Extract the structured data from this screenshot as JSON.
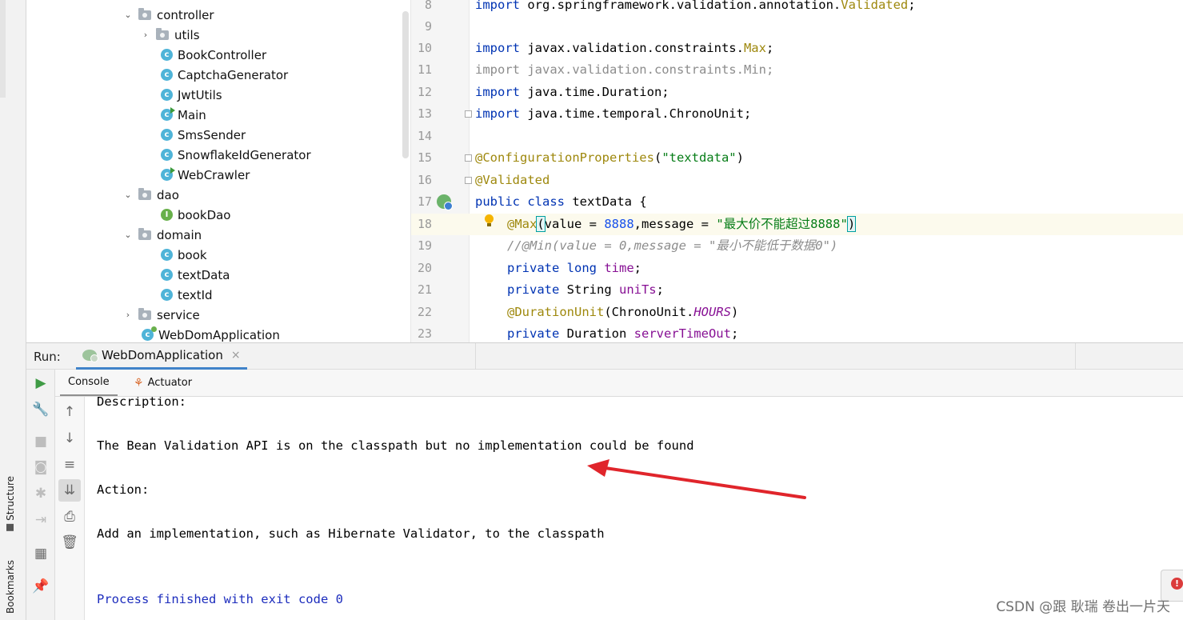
{
  "sidebar": {
    "structure_label": "Structure",
    "bookmarks_label": "Bookmarks"
  },
  "tree": {
    "items": [
      {
        "label": "controller",
        "type": "folder",
        "expanded": true,
        "indent": 0
      },
      {
        "label": "utils",
        "type": "folder",
        "expanded": false,
        "indent": 1
      },
      {
        "label": "BookController",
        "type": "class",
        "indent": 2
      },
      {
        "label": "CaptchaGenerator",
        "type": "class",
        "indent": 2
      },
      {
        "label": "JwtUtils",
        "type": "class",
        "indent": 2
      },
      {
        "label": "Main",
        "type": "runnable-class",
        "indent": 2
      },
      {
        "label": "SmsSender",
        "type": "class",
        "indent": 2
      },
      {
        "label": "SnowflakeIdGenerator",
        "type": "class",
        "indent": 2
      },
      {
        "label": "WebCrawler",
        "type": "runnable-class",
        "indent": 2
      },
      {
        "label": "dao",
        "type": "folder",
        "expanded": true,
        "indent": 0
      },
      {
        "label": "bookDao",
        "type": "interface",
        "indent": 2
      },
      {
        "label": "domain",
        "type": "folder",
        "expanded": true,
        "indent": 0
      },
      {
        "label": "book",
        "type": "class",
        "indent": 2
      },
      {
        "label": "textData",
        "type": "class",
        "indent": 2
      },
      {
        "label": "textId",
        "type": "class",
        "indent": 2
      },
      {
        "label": "service",
        "type": "folder",
        "expanded": false,
        "indent": 0
      },
      {
        "label": "WebDomApplication",
        "type": "spring-class",
        "indent": 0
      }
    ]
  },
  "editor": {
    "line_numbers": [
      "8",
      "9",
      "10",
      "11",
      "12",
      "13",
      "14",
      "15",
      "16",
      "17",
      "18",
      "19",
      "20",
      "21",
      "22",
      "23"
    ],
    "current_line": "18",
    "code": {
      "l8_kw": "import",
      "l8_rest": " org.springframework.validation.annotation.",
      "l8_ann": "Validated",
      "l8_end": ";",
      "l10_kw": "import",
      "l10_rest": " javax.validation.constraints.",
      "l10_ann": "Max",
      "l10_end": ";",
      "l11_text": "import javax.validation.constraints.Min;",
      "l12_kw": "import",
      "l12_rest": " java.time.Duration;",
      "l13_kw": "import",
      "l13_rest": " java.time.temporal.ChronoUnit;",
      "l15_ann": "@ConfigurationProperties",
      "l15_open": "(",
      "l15_str": "\"textdata\"",
      "l15_close": ")",
      "l16_ann": "@Validated",
      "l17_kw1": "public",
      "l17_kw2": "class",
      "l17_rest": " textData {",
      "l18_ann": "@Max",
      "l18_open": "(",
      "l18_a": "value = ",
      "l18_num": "8888",
      "l18_b": ",message = ",
      "l18_str": "\"最大价不能超过8888\"",
      "l18_close": ")",
      "l19_cmt": "//@Min(value = 0,message = \"最小不能低于数据0\")",
      "l20_kw1": "private",
      "l20_kw2": "long",
      "l20_field": "time",
      "l20_end": ";",
      "l21_kw": "private",
      "l21_type": " String ",
      "l21_field": "uniTs",
      "l21_end": ";",
      "l22_ann": "@DurationUnit",
      "l22_a": "(ChronoUnit.",
      "l22_static": "HOURS",
      "l22_b": ")",
      "l23_kw": "private",
      "l23_type": " Duration ",
      "l23_field": "serverTimeOut",
      "l23_end": ";"
    }
  },
  "run_panel": {
    "label": "Run:",
    "tab_title": "WebDomApplication",
    "tabs": [
      {
        "label": "Console",
        "selected": true
      },
      {
        "label": "Actuator",
        "selected": false
      }
    ]
  },
  "console": {
    "lines": [
      "Description:",
      "",
      "The Bean Validation API is on the classpath but no implementation could be found",
      "",
      "Action:",
      "",
      "Add an implementation, such as Hibernate Validator, to the classpath",
      "",
      "",
      "Process finished with exit code 0"
    ]
  },
  "annotation": {
    "arrow_color": "#e0252b"
  },
  "watermark": "CSDN @跟 耿瑞 卷出一片天",
  "error_badge": "!"
}
